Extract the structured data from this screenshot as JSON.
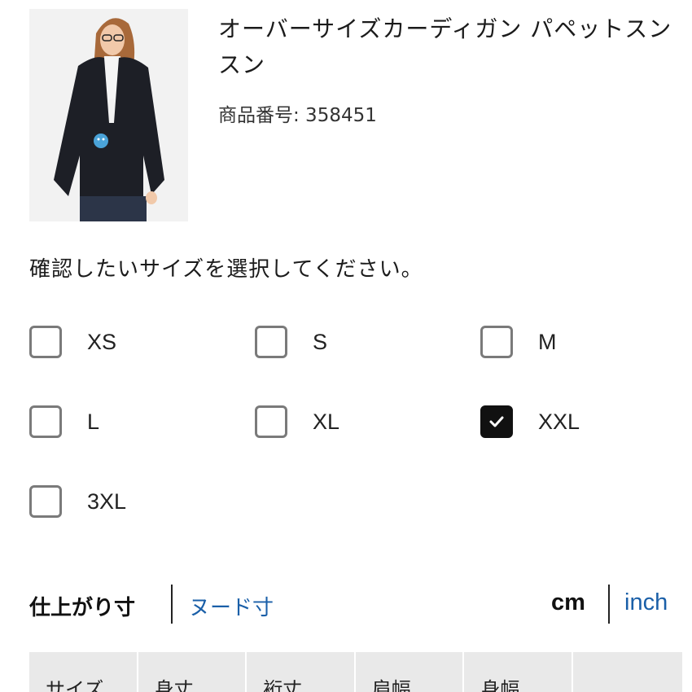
{
  "product": {
    "title": "オーバーサイズカーディガン パペットスンスン",
    "number_label": "商品番号: 358451"
  },
  "size_selector": {
    "prompt": "確認したいサイズを選択してください。",
    "options": [
      {
        "label": "XS",
        "checked": false
      },
      {
        "label": "S",
        "checked": false
      },
      {
        "label": "M",
        "checked": false
      },
      {
        "label": "L",
        "checked": false
      },
      {
        "label": "XL",
        "checked": false
      },
      {
        "label": "XXL",
        "checked": true
      },
      {
        "label": "3XL",
        "checked": false
      }
    ]
  },
  "measure_tabs": {
    "finished": "仕上がり寸",
    "nude": "ヌード寸"
  },
  "units": {
    "cm": "cm",
    "inch": "inch"
  },
  "table": {
    "headers": [
      "サイズ",
      "身丈",
      "裄丈",
      "肩幅",
      "身幅",
      ""
    ]
  },
  "colors": {
    "link_blue": "#1a5fa8",
    "checkbox_checked": "#111111",
    "table_header_bg": "#e9e9e9"
  }
}
